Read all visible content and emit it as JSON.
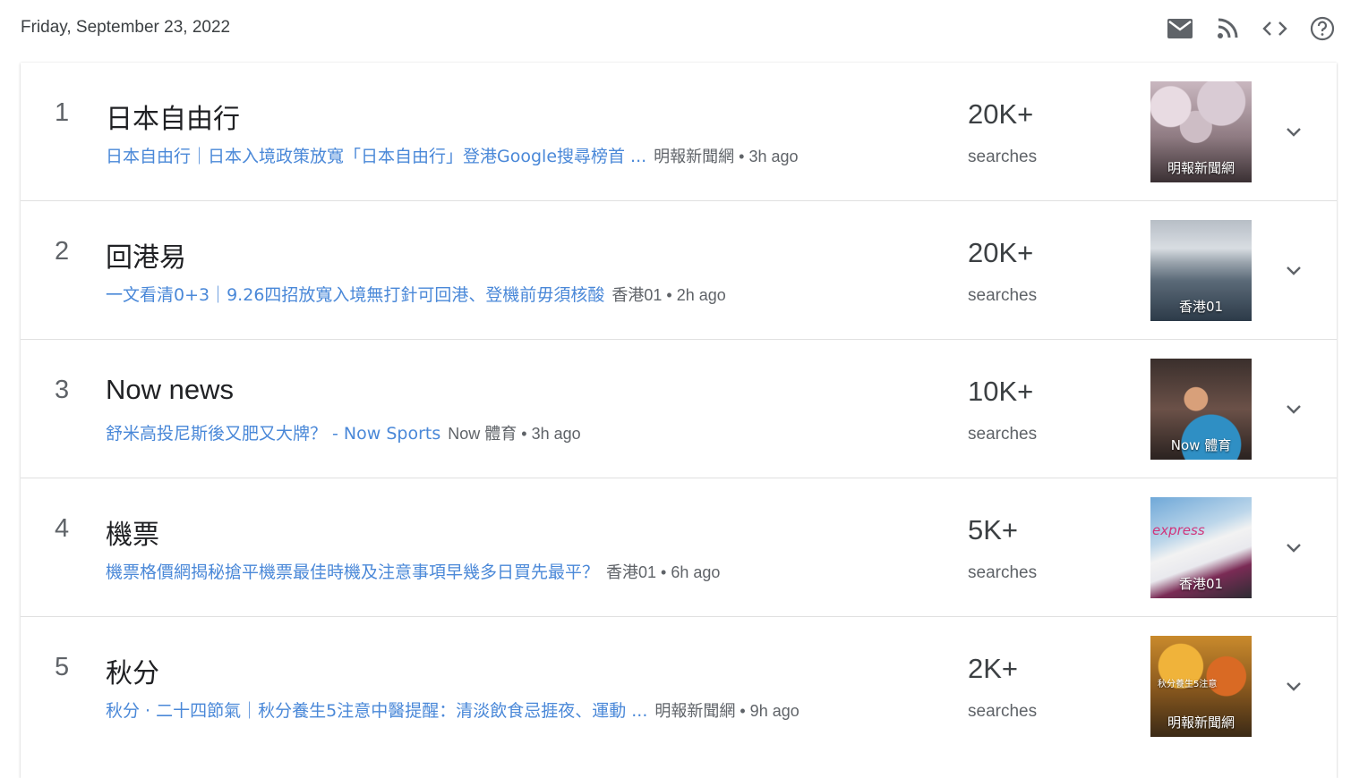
{
  "header": {
    "date": "Friday, September 23, 2022",
    "icons": [
      "mail-icon",
      "rss-icon",
      "embed-code-icon",
      "help-icon"
    ]
  },
  "trends": [
    {
      "rank": "1",
      "title": "日本自由行",
      "article_title": "日本自由行｜日本入境政策放寬「日本自由行」登港Google搜尋榜首 ...",
      "article_meta": "明報新聞網 • 3h ago",
      "count": "20K+",
      "count_label": "searches",
      "thumb_caption": "明報新聞網",
      "thumb_overlay": ""
    },
    {
      "rank": "2",
      "title": "回港易",
      "article_title": "一文看清0+3｜9.26四招放寬入境無打針可回港、登機前毋須核酸",
      "article_meta": "香港01 • 2h ago",
      "count": "20K+",
      "count_label": "searches",
      "thumb_caption": "香港01",
      "thumb_overlay": ""
    },
    {
      "rank": "3",
      "title": "Now news",
      "article_title": "舒米高投尼斯後又肥又大牌？ - Now Sports",
      "article_meta": "Now 體育 • 3h ago",
      "count": "10K+",
      "count_label": "searches",
      "thumb_caption": "Now 體育",
      "thumb_overlay": ""
    },
    {
      "rank": "4",
      "title": "機票",
      "article_title": "機票格價網揭秘搶平機票最佳時機及注意事項早幾多日買先最平？",
      "article_meta": "香港01 • 6h ago",
      "count": "5K+",
      "count_label": "searches",
      "thumb_caption": "香港01",
      "thumb_overlay": "express"
    },
    {
      "rank": "5",
      "title": "秋分",
      "article_title": "秋分 · 二十四節氣｜秋分養生5注意中醫提醒：清淡飲食忌捱夜、運動 ...",
      "article_meta": "明報新聞網 • 9h ago",
      "count": "2K+",
      "count_label": "searches",
      "thumb_caption": "明報新聞網",
      "thumb_overlay": "秋分養生5注意"
    }
  ],
  "colors": {
    "link": "#4a88d8",
    "text": "#202124",
    "muted": "#5f6368"
  }
}
